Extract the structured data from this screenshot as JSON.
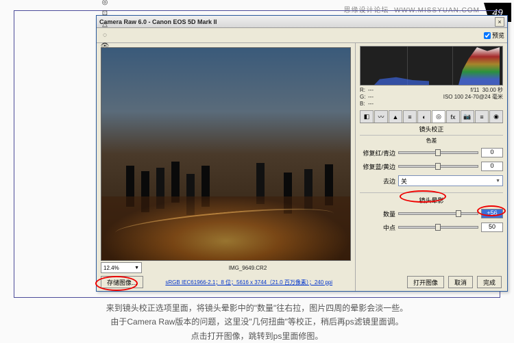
{
  "watermark": {
    "forum": "思缘设计论坛",
    "url": "WWW.MISSYUAN.COM",
    "step": "49"
  },
  "window": {
    "title": "Camera Raw 6.0 - Canon EOS 5D Mark II",
    "close": "×"
  },
  "toolbar": {
    "preview_label": "预览",
    "tools": [
      "zoom-icon",
      "hand-icon",
      "eyedropper-icon",
      "sampler-icon",
      "crop-icon",
      "straighten-icon",
      "spot-icon",
      "redeye-icon",
      "adjust-icon",
      "grad-icon",
      "rotate-ccw-icon",
      "rotate-cw-icon",
      "prefs-icon"
    ],
    "glyphs": [
      "🔍",
      "✋",
      "✎",
      "◎",
      "⊡",
      "△",
      "◌",
      "👁",
      "≡",
      "◧",
      "↶",
      "↷",
      "⚙"
    ]
  },
  "exif": {
    "r_label": "R:",
    "g_label": "G:",
    "b_label": "B:",
    "r": "---",
    "g": "---",
    "b": "---",
    "aperture": "f/11",
    "shutter": "30.00 秒",
    "iso_lens": "ISO 100   24-70@24 毫米"
  },
  "tabs": [
    "basic-icon",
    "curve-icon",
    "detail-icon",
    "hsl-icon",
    "split-icon",
    "lens-icon",
    "fx-icon",
    "cal-icon",
    "preset-icon",
    "snapshot-icon"
  ],
  "tab_glyphs": [
    "◧",
    "〰",
    "▲",
    "≡",
    "◐",
    "◎",
    "fx",
    "📷",
    "≡",
    "◉"
  ],
  "active_tab_idx": 5,
  "tab_title": "镜头校正",
  "panel": {
    "sub_label": "色差",
    "red_cyan_label": "修复红/青边",
    "red_cyan_val": "0",
    "blue_yellow_label": "修复蓝/黄边",
    "blue_yellow_val": "0",
    "defringe_label": "去边",
    "defringe_val": "关",
    "vignette_header": "镜头晕影",
    "amount_label": "数量",
    "amount_val": "+56",
    "midpoint_label": "中点",
    "midpoint_val": "50"
  },
  "zoom": "12.4%",
  "filename": "IMG_9649.CR2",
  "metadata_link": "sRGB IEC61966-2.1；8 位；5616 x 3744（21.0 百万像素）；240 ppi",
  "buttons": {
    "save": "存储图像...",
    "open": "打开图像",
    "cancel": "取消",
    "done": "完成"
  },
  "caption": {
    "l1": "来到镜头校正选项里面，将镜头晕影中的\"数量\"往右拉，图片四周的晕影会淡一些。",
    "l2": "由于Camera Raw版本的问题，这里没\"几何扭曲\"等校正，稍后再ps滤镜里面调。",
    "l3": "点击打开图像，跳转到ps里面修图。"
  }
}
